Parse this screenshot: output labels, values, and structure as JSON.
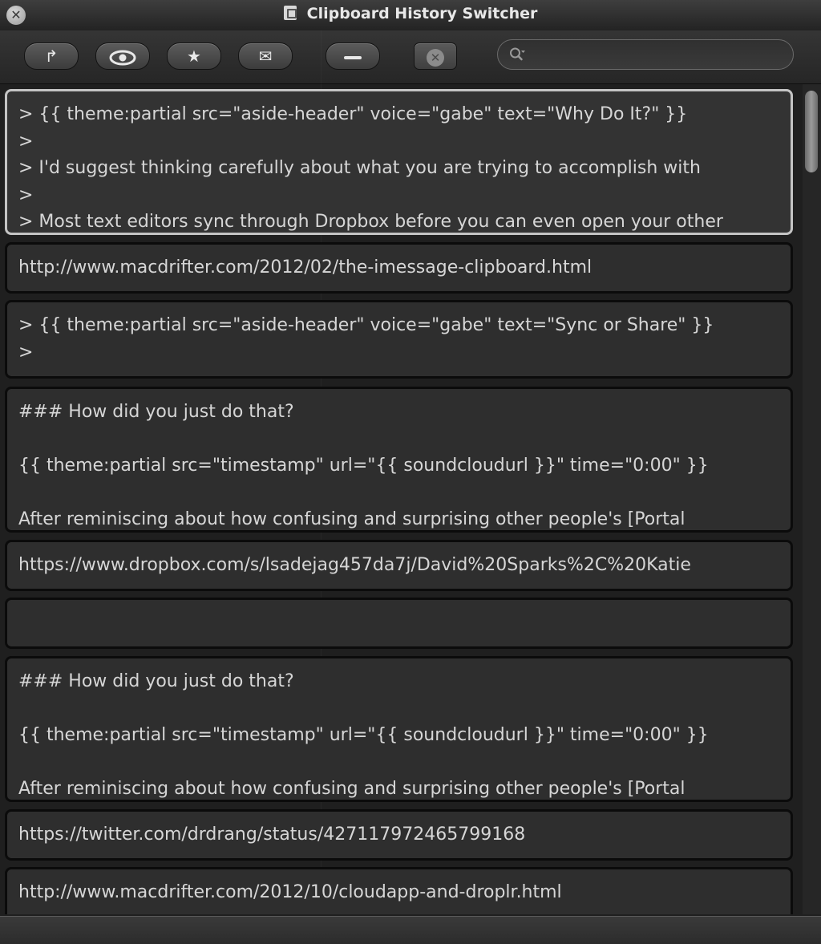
{
  "window": {
    "title": "Clipboard History Switcher",
    "close_glyph": "✕"
  },
  "toolbar": {
    "buttons": [
      {
        "name": "paste-action",
        "icon": "redo-arrow-icon",
        "glyph": "↱"
      },
      {
        "name": "preview",
        "icon": "eye-icon",
        "glyph": "👁"
      },
      {
        "name": "favorite",
        "icon": "star-icon",
        "glyph": "★"
      },
      {
        "name": "share",
        "icon": "envelope-icon",
        "glyph": "✉"
      },
      {
        "name": "remove",
        "icon": "minus-icon",
        "glyph": ""
      },
      {
        "name": "delete-all",
        "icon": "circle-x-icon",
        "glyph": "✕"
      }
    ],
    "search": {
      "placeholder": "",
      "value": ""
    }
  },
  "clips": [
    {
      "text": "> {{ theme:partial src=\"aside-header\" voice=\"gabe\" text=\"Why Do It?\" }}\n>\n> I'd suggest thinking carefully about what you are trying to accomplish with\n>\n> Most text editors sync through Dropbox before you can even open your other",
      "selected": true
    },
    {
      "text": "http://www.macdrifter.com/2012/02/the-imessage-clipboard.html",
      "selected": false
    },
    {
      "text": "> {{ theme:partial src=\"aside-header\" voice=\"gabe\" text=\"Sync or Share\" }}\n>",
      "selected": false
    },
    {
      "text": "### How did you just do that?\n\n{{ theme:partial src=\"timestamp\" url=\"{{ soundcloudurl }}\" time=\"0:00\" }}\n\nAfter reminiscing about how confusing and surprising other people's [Portal",
      "selected": false
    },
    {
      "text": "https://www.dropbox.com/s/lsadejag457da7j/David%20Sparks%2C%20Katie",
      "selected": false
    },
    {
      "text": "",
      "selected": false
    },
    {
      "text": "### How did you just do that?\n\n{{ theme:partial src=\"timestamp\" url=\"{{ soundcloudurl }}\" time=\"0:00\" }}\n\nAfter reminiscing about how confusing and surprising other people's [Portal",
      "selected": false
    },
    {
      "text": "https://twitter.com/drdrang/status/427117972465799168",
      "selected": false
    },
    {
      "text": "http://www.macdrifter.com/2012/10/cloudapp-and-droplr.html",
      "selected": false
    }
  ]
}
